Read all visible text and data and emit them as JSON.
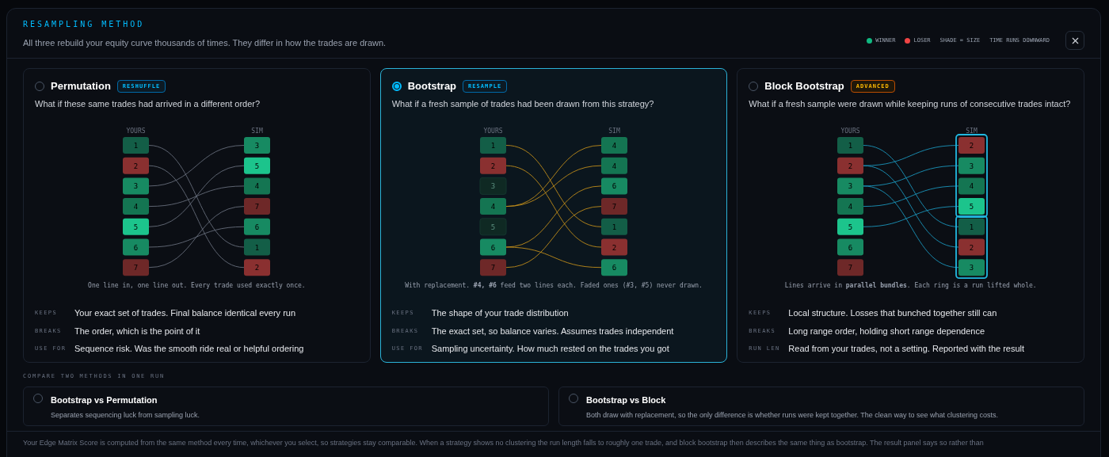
{
  "header": {
    "title": "RESAMPLING METHOD",
    "subtitle": "All three rebuild your equity curve thousands of times. They differ in how the trades are drawn."
  },
  "legend": [
    {
      "kind": "dot",
      "label": "WINNER",
      "color": "#10b981"
    },
    {
      "kind": "dot",
      "label": "LOSER",
      "color": "#ef4444"
    },
    {
      "kind": "note",
      "label": "SHADE = SIZE"
    },
    {
      "kind": "note",
      "label": "TIME RUNS DOWNWARD"
    }
  ],
  "methods": [
    {
      "kind": "permutation",
      "name": "Permutation",
      "badge": "RESHUFFLE",
      "selected": false,
      "question": "What if these same trades had arrived in a different order?",
      "yours_label": "YOURS",
      "sim_label": "SIM",
      "yours": [
        {
          "label": "1",
          "color": "#135e47",
          "faded": false
        },
        {
          "label": "2",
          "color": "#8a3030",
          "faded": false
        },
        {
          "label": "3",
          "color": "#178a62",
          "faded": false
        },
        {
          "label": "4",
          "color": "#147552",
          "faded": false
        },
        {
          "label": "5",
          "color": "#1cc48c",
          "faded": false
        },
        {
          "label": "6",
          "color": "#178a62",
          "faded": false
        },
        {
          "label": "7",
          "color": "#6e2828",
          "faded": false
        }
      ],
      "sim": [
        {
          "label": "3",
          "color": "#178a62"
        },
        {
          "label": "5",
          "color": "#1cc48c"
        },
        {
          "label": "4",
          "color": "#147552"
        },
        {
          "label": "7",
          "color": "#6e2828"
        },
        {
          "label": "6",
          "color": "#178a62"
        },
        {
          "label": "1",
          "color": "#135e47"
        },
        {
          "label": "2",
          "color": "#8a3030"
        }
      ],
      "caption": "One line in, one line out. Every trade used exactly once.",
      "facts": [
        {
          "key": "KEEPS",
          "text": "Your exact set of trades. Final balance identical every run"
        },
        {
          "key": "BREAKS",
          "text": "The order, which is the point of it"
        },
        {
          "key": "USE FOR",
          "text": "Sequence risk. Was the smooth ride real or helpful ordering"
        }
      ]
    },
    {
      "kind": "bootstrap",
      "name": "Bootstrap",
      "badge": "RESAMPLE",
      "selected": true,
      "question": "What if a fresh sample of trades had been drawn from this strategy?",
      "yours_label": "YOURS",
      "sim_label": "SIM",
      "yours": [
        {
          "label": "1",
          "color": "#135e47",
          "faded": false
        },
        {
          "label": "2",
          "color": "#8a3030",
          "faded": false
        },
        {
          "label": "3",
          "color": "#0f2923",
          "faded": true
        },
        {
          "label": "4",
          "color": "#147552",
          "faded": false
        },
        {
          "label": "5",
          "color": "#0f2923",
          "faded": true
        },
        {
          "label": "6",
          "color": "#178a62",
          "faded": false
        },
        {
          "label": "7",
          "color": "#6e2828",
          "faded": false
        }
      ],
      "sim": [
        {
          "label": "4",
          "color": "#147552"
        },
        {
          "label": "4",
          "color": "#147552"
        },
        {
          "label": "6",
          "color": "#178a62"
        },
        {
          "label": "7",
          "color": "#6e2828"
        },
        {
          "label": "1",
          "color": "#135e47"
        },
        {
          "label": "2",
          "color": "#8a3030"
        },
        {
          "label": "6",
          "color": "#178a62"
        }
      ],
      "caption": "With replacement. **#4, #6** feed two lines each. Faded ones (#3, #5) never drawn.",
      "facts": [
        {
          "key": "KEEPS",
          "text": "The shape of your trade distribution"
        },
        {
          "key": "BREAKS",
          "text": "The exact set, so balance varies. Assumes trades independent"
        },
        {
          "key": "USE FOR",
          "text": "Sampling uncertainty. How much rested on the trades you got"
        }
      ]
    },
    {
      "kind": "block",
      "name": "Block Bootstrap",
      "badge": "ADVANCED",
      "selected": false,
      "question": "What if a fresh sample were drawn while keeping runs of consecutive trades intact?",
      "yours_label": "YOURS",
      "sim_label": "SIM",
      "yours": [
        {
          "label": "1",
          "color": "#135e47",
          "faded": false
        },
        {
          "label": "2",
          "color": "#8a3030",
          "faded": false
        },
        {
          "label": "3",
          "color": "#178a62",
          "faded": false
        },
        {
          "label": "4",
          "color": "#147552",
          "faded": false
        },
        {
          "label": "5",
          "color": "#1cc48c",
          "faded": false
        },
        {
          "label": "6",
          "color": "#178a62",
          "faded": false
        },
        {
          "label": "7",
          "color": "#6e2828",
          "faded": false
        }
      ],
      "sim": [
        {
          "label": "2",
          "color": "#8a3030"
        },
        {
          "label": "3",
          "color": "#178a62"
        },
        {
          "label": "4",
          "color": "#147552"
        },
        {
          "label": "5",
          "color": "#1cc48c"
        },
        {
          "label": "1",
          "color": "#135e47"
        },
        {
          "label": "2",
          "color": "#8a3030"
        },
        {
          "label": "3",
          "color": "#178a62"
        }
      ],
      "caption": "Lines arrive in **parallel bundles**. Each ring is a run lifted whole.",
      "facts": [
        {
          "key": "KEEPS",
          "text": "Local structure. Losses that bunched together still can"
        },
        {
          "key": "BREAKS",
          "text": "Long range order, holding short range dependence"
        },
        {
          "key": "RUN LEN",
          "text": "Read from your trades, not a setting. Reported with the result"
        }
      ]
    }
  ],
  "compare": {
    "title": "COMPARE TWO METHODS IN ONE RUN",
    "options": [
      {
        "title": "Bootstrap vs Permutation",
        "description": "Separates sequencing luck from sampling luck.",
        "selected": false
      },
      {
        "title": "Bootstrap vs Block",
        "description": "Both draw with replacement, so the only difference is whether runs were kept together. The clean way to see what clustering costs.",
        "selected": false
      }
    ]
  },
  "footer": "Your Edge Matrix Score is computed from the same method every time, whichever you select, so strategies stay comparable. When a strategy shows no clustering the run length falls to roughly one trade, and block bootstrap then describes the same thing as bootstrap. The result panel says so rather than"
}
